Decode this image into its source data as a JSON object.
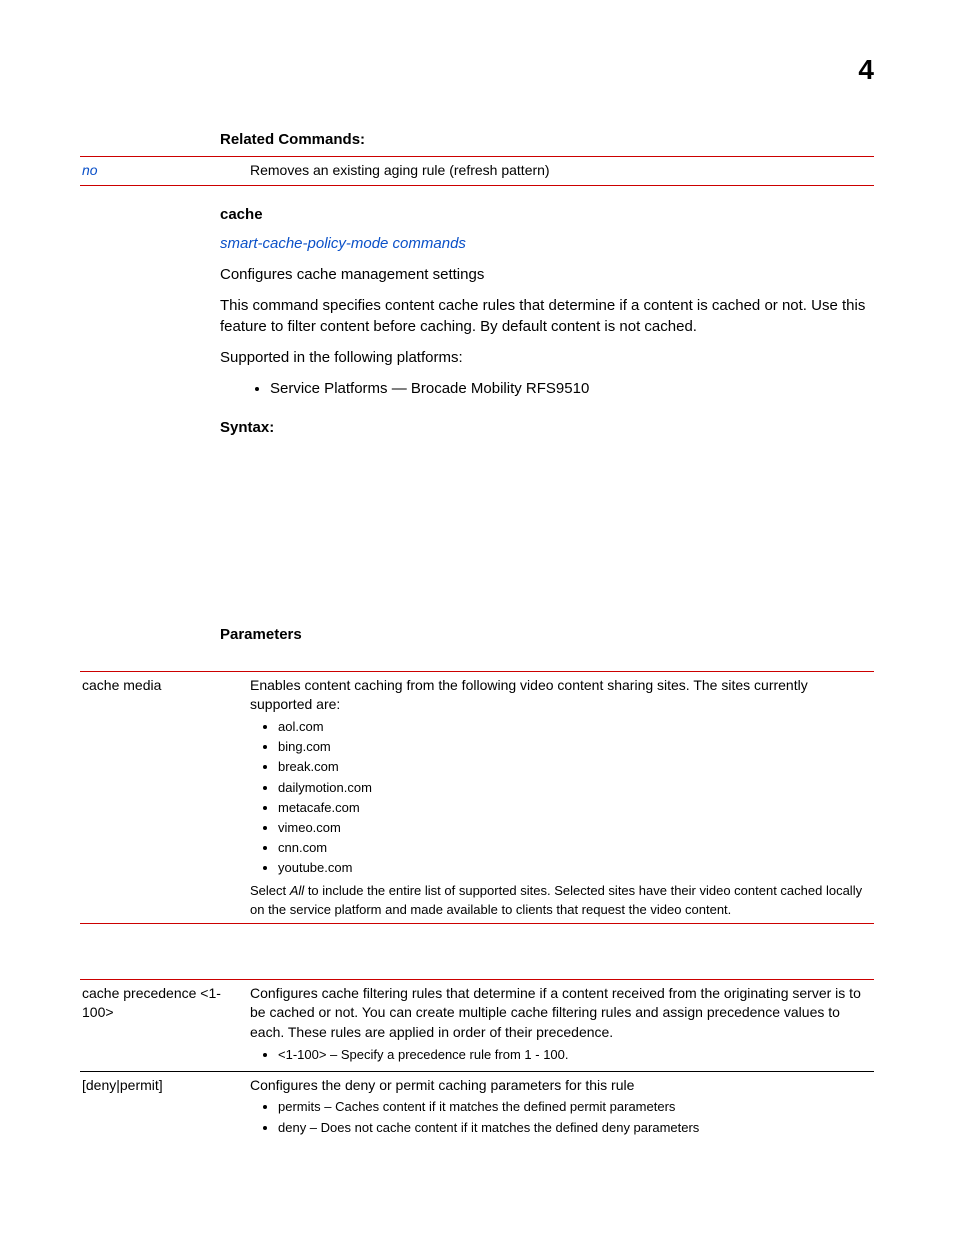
{
  "pageNumber": "4",
  "relatedCommands": {
    "heading": "Related Commands:",
    "row": {
      "key": "no",
      "value": "Removes an existing aging rule (refresh pattern)"
    }
  },
  "cacheSection": {
    "heading": "cache",
    "link": "smart-cache-policy-mode commands",
    "p1": "Configures cache management settings",
    "p2": "This command specifies content cache rules that determine if a content is cached or not. Use this feature to filter content before caching. By default content is not cached.",
    "p3": "Supported in the following platforms:",
    "platformItem": "Service Platforms — Brocade Mobility RFS9510"
  },
  "syntaxHeading": "Syntax:",
  "parametersHeading": "Parameters",
  "paramTable1": {
    "key": "cache media",
    "intro": "Enables content caching from the following video content sharing sites. The sites currently supported are:",
    "sites": [
      "aol.com",
      "bing.com",
      "break.com",
      "dailymotion.com",
      "metacafe.com",
      "vimeo.com",
      "cnn.com",
      "youtube.com"
    ],
    "note_pre": "Select ",
    "note_emph": "All",
    "note_post": " to include the entire list of supported sites. Selected sites have their video content cached locally on the service platform and made available to clients that request the video content."
  },
  "paramTable2": {
    "row1": {
      "key": "cache precedence <1-100>",
      "text": "Configures cache filtering rules that determine if a content received from the originating server is to be cached or not. You can create multiple cache filtering rules and assign precedence values to each. These rules are applied in order of their precedence.",
      "bullet": "<1-100> – Specify a precedence rule from 1 - 100."
    },
    "row2": {
      "key": "[deny|permit]",
      "text": "Configures the deny or permit caching parameters for this rule",
      "b1": "permits – Caches content if it matches the defined permit parameters",
      "b2": "deny – Does not cache content if it matches the defined deny parameters"
    }
  }
}
